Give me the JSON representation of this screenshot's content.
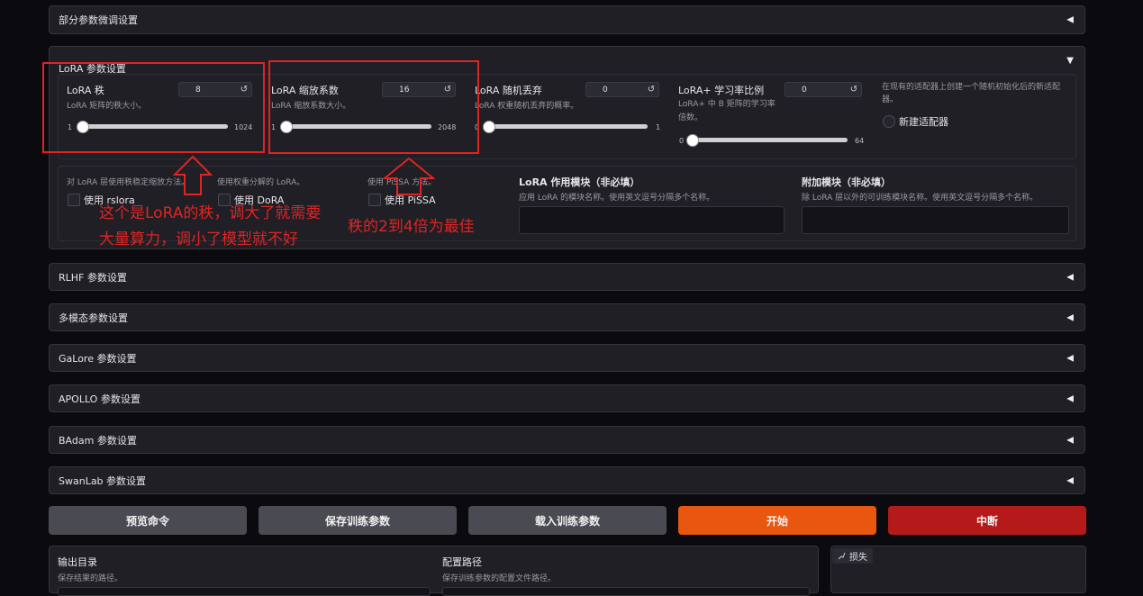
{
  "sections": {
    "partial_params": "部分参数微调设置",
    "lora_params": "LoRA 参数设置",
    "rlhf": "RLHF 参数设置",
    "multimodal": "多模态参数设置",
    "galore": "GaLore 参数设置",
    "apollo": "APOLLO 参数设置",
    "badam": "BAdam 参数设置",
    "swanlab": "SwanLab 参数设置"
  },
  "icons": {
    "collapsed": "◀",
    "expanded": "▼",
    "reset": "↺"
  },
  "lora": {
    "rank": {
      "label": "LoRA 秩",
      "desc": "LoRA 矩阵的秩大小。",
      "value": "8",
      "min": "1",
      "max": "1024",
      "fraction": 0.007
    },
    "alpha": {
      "label": "LoRA 缩放系数",
      "desc": "LoRA 缩放系数大小。",
      "value": "16",
      "min": "1",
      "max": "2048",
      "fraction": 0.007
    },
    "dropout": {
      "label": "LoRA 随机丢弃",
      "desc": "LoRA 权重随机丢弃的概率。",
      "value": "0",
      "min": "0",
      "max": "1",
      "fraction": 0.0
    },
    "plus_ratio": {
      "label": "LoRA+ 学习率比例",
      "desc": "LoRA+ 中 B 矩阵的学习率倍数。",
      "value": "0",
      "min": "0",
      "max": "64",
      "fraction": 0.0
    },
    "new_adapter": {
      "desc": "在现有的适配器上创建一个随机初始化后的新适配器。",
      "label": "新建适配器"
    },
    "rslora": {
      "desc": "对 LoRA 层使用秩稳定缩放方法。",
      "label": "使用 rslora"
    },
    "dora": {
      "desc": "使用权重分解的 LoRA。",
      "label": "使用 DoRA"
    },
    "pissa": {
      "desc": "使用 PiSSA 方法。",
      "label": "使用 PiSSA"
    },
    "target": {
      "label": "LoRA 作用模块（非必填）",
      "desc": "应用 LoRA 的模块名称。使用英文逗号分隔多个名称。"
    },
    "additional": {
      "label": "附加模块（非必填）",
      "desc": "除 LoRA 层以外的可训练模块名称。使用英文逗号分隔多个名称。"
    }
  },
  "annotations": {
    "rank_note_line1": "这个是LoRA的秩，调大了就需要",
    "rank_note_line2": "大量算力，调小了模型就不好",
    "alpha_note": "秩的2到4倍为最佳"
  },
  "buttons": {
    "preview": "预览命令",
    "save": "保存训练参数",
    "load": "载入训练参数",
    "start": "开始",
    "abort": "中断"
  },
  "colors": {
    "start": "#e8560f",
    "abort": "#b51a1a",
    "secondary": "#4a4a52",
    "annotation": "#e02424"
  },
  "output": {
    "dir_label": "输出目录",
    "dir_desc": "保存结果的路径。",
    "config_label": "配置路径",
    "config_desc": "保存训练参数的配置文件路径。",
    "loss_label": "损失"
  }
}
